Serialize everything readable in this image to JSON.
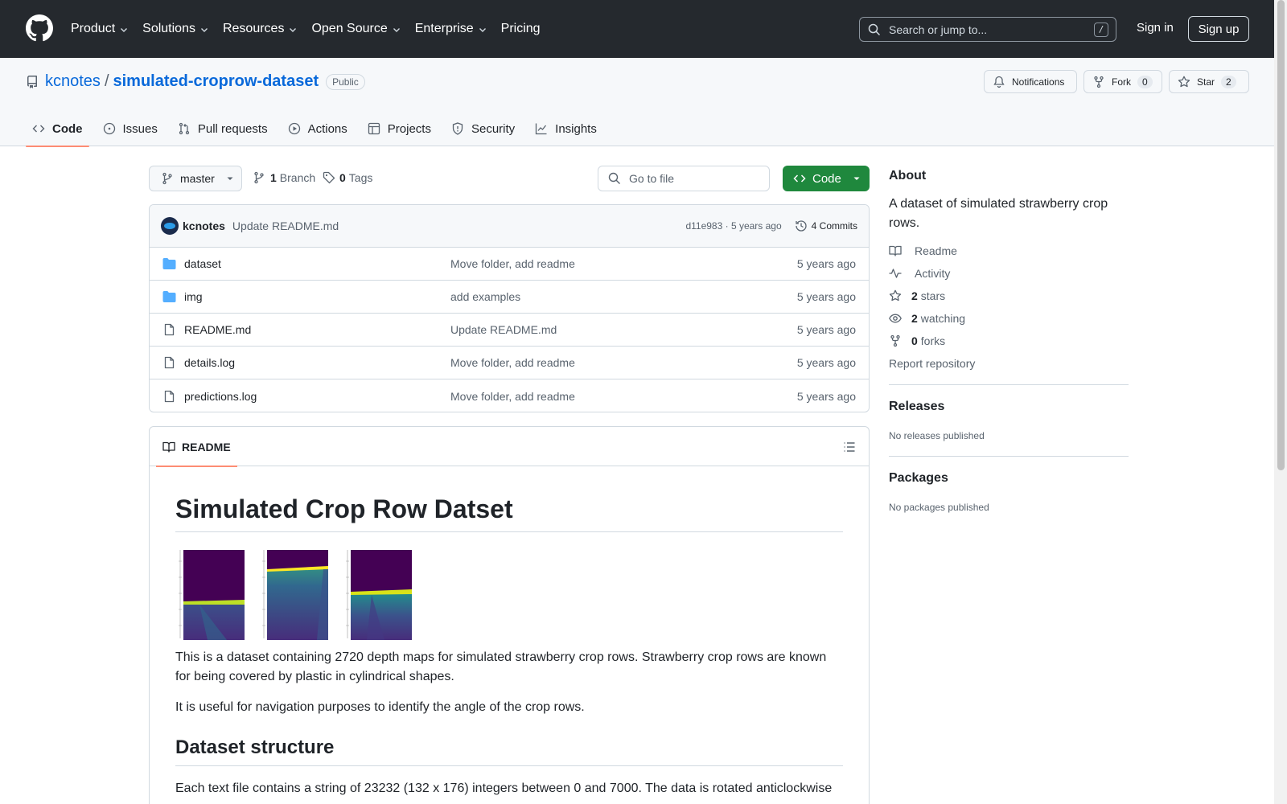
{
  "header": {
    "nav": [
      {
        "label": "Product",
        "dropdown": true
      },
      {
        "label": "Solutions",
        "dropdown": true
      },
      {
        "label": "Resources",
        "dropdown": true
      },
      {
        "label": "Open Source",
        "dropdown": true
      },
      {
        "label": "Enterprise",
        "dropdown": true
      },
      {
        "label": "Pricing",
        "dropdown": false
      }
    ],
    "search_placeholder": "Search or jump to...",
    "search_shortcut": "/",
    "signin": "Sign in",
    "signup": "Sign up"
  },
  "repo": {
    "owner": "kcnotes",
    "separator": "/",
    "name": "simulated-croprow-dataset",
    "visibility": "Public",
    "notifications": "Notifications",
    "fork_label": "Fork",
    "fork_count": "0",
    "star_label": "Star",
    "star_count": "2",
    "tabs": [
      {
        "label": "Code",
        "icon": "code-icon",
        "active": true
      },
      {
        "label": "Issues",
        "icon": "issue-icon",
        "active": false
      },
      {
        "label": "Pull requests",
        "icon": "pull-request-icon",
        "active": false
      },
      {
        "label": "Actions",
        "icon": "play-icon",
        "active": false
      },
      {
        "label": "Projects",
        "icon": "table-icon",
        "active": false
      },
      {
        "label": "Security",
        "icon": "shield-icon",
        "active": false
      },
      {
        "label": "Insights",
        "icon": "graph-icon",
        "active": false
      }
    ]
  },
  "toolbar": {
    "branch": "master",
    "branch_count": "1",
    "branch_label": "Branch",
    "tag_count": "0",
    "tag_label": "Tags",
    "goto_placeholder": "Go to file",
    "code_button": "Code"
  },
  "commit": {
    "author": "kcnotes",
    "message": "Update README.md",
    "meta": "d11e983 · 5 years ago",
    "commits": "4 Commits"
  },
  "files": [
    {
      "name": "dataset",
      "type": "folder",
      "message": "Move folder, add readme",
      "age": "5 years ago"
    },
    {
      "name": "img",
      "type": "folder",
      "message": "add examples",
      "age": "5 years ago"
    },
    {
      "name": "README.md",
      "type": "file",
      "message": "Update README.md",
      "age": "5 years ago"
    },
    {
      "name": "details.log",
      "type": "file",
      "message": "Move folder, add readme",
      "age": "5 years ago"
    },
    {
      "name": "predictions.log",
      "type": "file",
      "message": "Move folder, add readme",
      "age": "5 years ago"
    }
  ],
  "readme": {
    "tab": "README",
    "title": "Simulated Crop Row Datset",
    "para1": "This is a dataset containing 2720 depth maps for simulated strawberry crop rows. Strawberry crop rows are known for being covered by plastic in cylindrical shapes.",
    "para2": "It is useful for navigation purposes to identify the angle of the crop rows.",
    "h2": "Dataset structure",
    "para3": "Each text file contains a string of 23232 (132 x 176) integers between 0 and 7000. The data is rotated anticlockwise"
  },
  "sidebar": {
    "about_title": "About",
    "description": "A dataset of simulated strawberry crop rows.",
    "items": [
      {
        "icon": "book-icon",
        "count": "",
        "label": "Readme"
      },
      {
        "icon": "pulse-icon",
        "count": "",
        "label": "Activity"
      },
      {
        "icon": "star-icon",
        "count": "2",
        "label": "stars"
      },
      {
        "icon": "eye-icon",
        "count": "2",
        "label": "watching"
      },
      {
        "icon": "fork-icon",
        "count": "0",
        "label": "forks"
      }
    ],
    "report": "Report repository",
    "releases_title": "Releases",
    "releases_note": "No releases published",
    "packages_title": "Packages",
    "packages_note": "No packages published"
  },
  "colors": {
    "header_bg": "#25292e",
    "link": "#0969da",
    "primary_button": "#1f883d",
    "tab_underline": "#fd8c73",
    "folder": "#54aeff"
  }
}
